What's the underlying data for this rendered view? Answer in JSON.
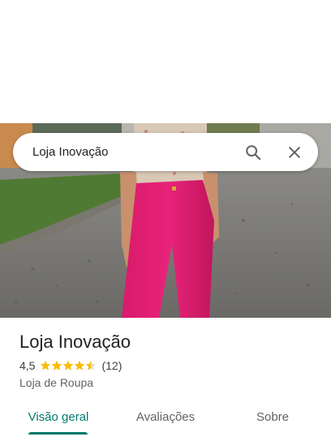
{
  "search": {
    "query": "Loja Inovação",
    "search_icon": "search-icon",
    "close_icon": "close-icon"
  },
  "place": {
    "name": "Loja Inovação",
    "rating": "4,5",
    "rating_value": 4.5,
    "stars_total": 5,
    "reviews": "(12)",
    "category": "Loja de Roupa"
  },
  "tabs": [
    {
      "label": "Visão geral",
      "active": true
    },
    {
      "label": "Avaliações",
      "active": false
    },
    {
      "label": "Sobre",
      "active": false
    }
  ],
  "colors": {
    "accent": "#00796b",
    "star": "#fbbc04",
    "text_primary": "#202124",
    "text_secondary": "#5f6368"
  }
}
